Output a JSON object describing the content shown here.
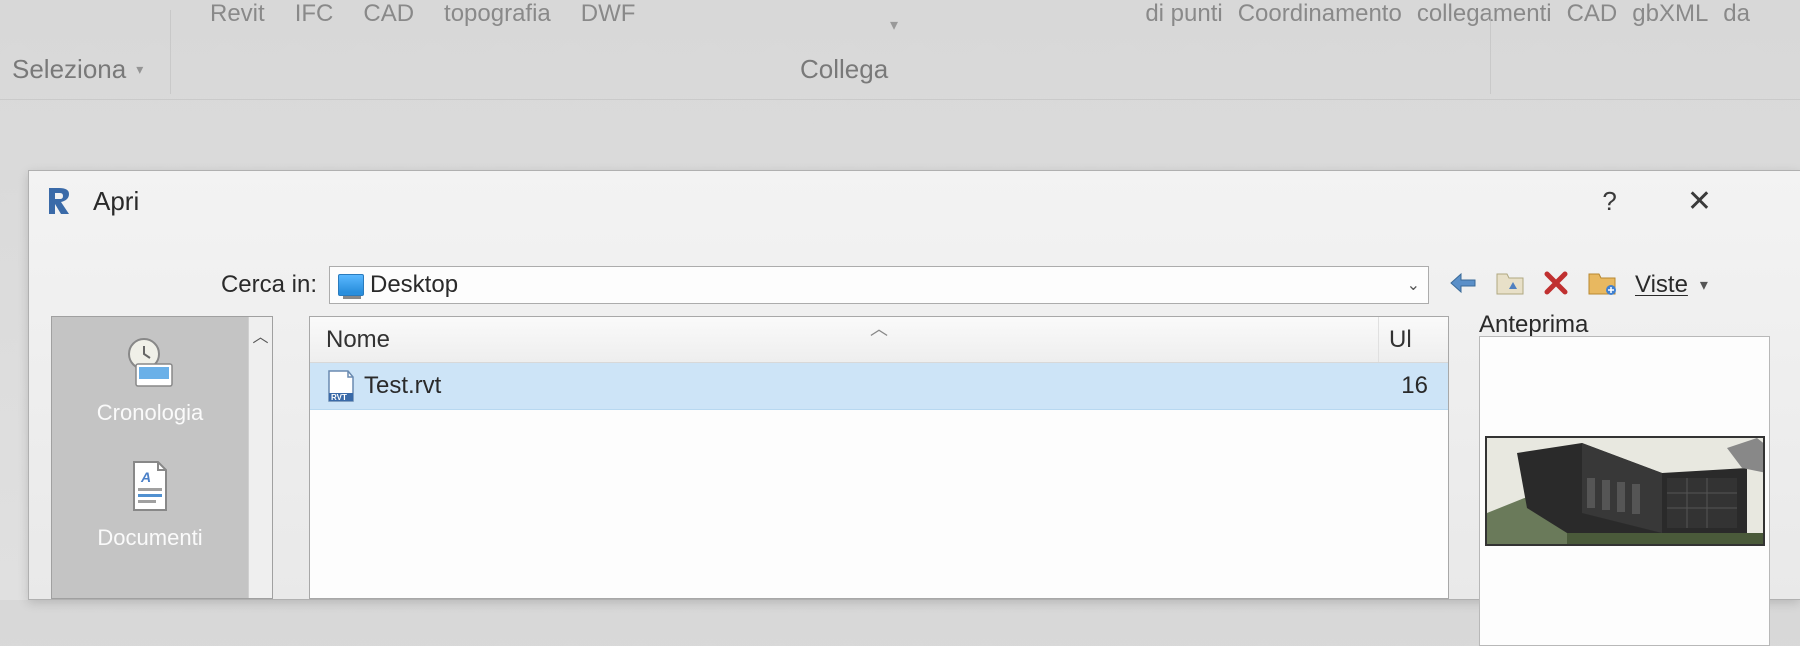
{
  "ribbon": {
    "upper_left": [
      "Revit",
      "IFC",
      "CAD",
      "topografia",
      "DWF"
    ],
    "upper_right": [
      "di punti",
      "Coordinamento",
      "collegamenti",
      "CAD",
      "gbXML",
      "da"
    ],
    "seleziona": "Seleziona",
    "collega": "Collega"
  },
  "dialog": {
    "title": "Apri",
    "help": "?",
    "close": "✕",
    "lookin_label": "Cerca in:",
    "lookin_value": "Desktop",
    "viste": "Viste",
    "anteprima": "Anteprima"
  },
  "sidebar": {
    "items": [
      {
        "label": "Cronologia"
      },
      {
        "label": "Documenti"
      }
    ]
  },
  "filelist": {
    "header": {
      "nome": "Nome",
      "ul": "Ul"
    },
    "rows": [
      {
        "name": "Test.rvt",
        "size": "16"
      }
    ]
  }
}
